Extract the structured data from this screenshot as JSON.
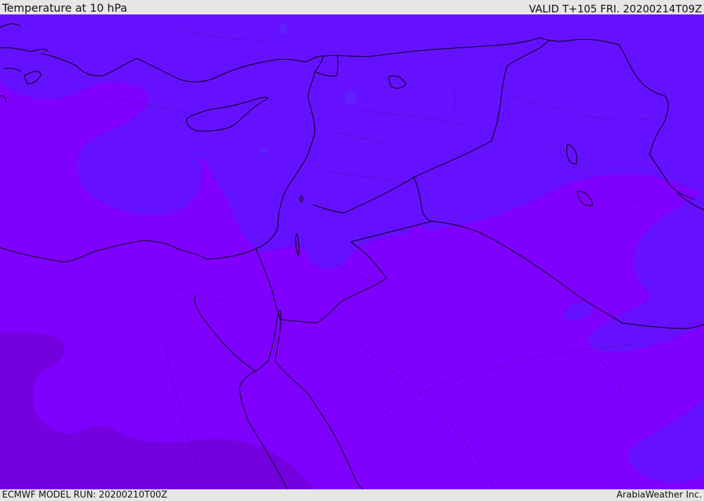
{
  "header": {
    "title": "Temperature at 10 hPa",
    "valid": "VALID T+105 FRI. 20200214T09Z"
  },
  "footer": {
    "model_run": "ECMWF MODEL RUN: 20200210T00Z",
    "credit": "ArabiaWeather Inc."
  },
  "colors": {
    "field_base": "#7f00ff",
    "field_warm": "#6511ff",
    "field_warmer": "#5f22ff",
    "field_cold": "#7400e0",
    "coastline": "#000000",
    "border": "#000000"
  },
  "map": {
    "variable": "temperature",
    "level": "10 hPa",
    "region": "Eastern Mediterranean / Middle East",
    "features": [
      "coastlines",
      "country borders (solid)",
      "internal boundaries (dotted)"
    ]
  }
}
